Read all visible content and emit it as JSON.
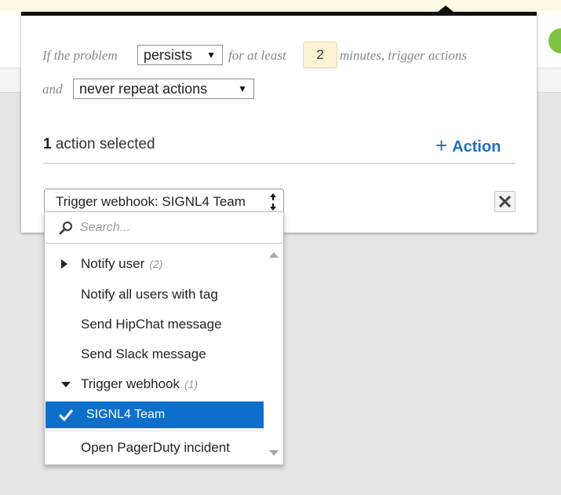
{
  "condition": {
    "prefix": "If the problem",
    "mode_value": "persists",
    "middle": "for at least",
    "minutes_value": "2",
    "suffix": "minutes, trigger actions",
    "and_label": "and",
    "repeat_value": "never repeat actions"
  },
  "actions": {
    "count": "1",
    "count_label": "action selected",
    "add_label": "Action"
  },
  "combo": {
    "value": "Trigger webhook: SIGNL4 Team"
  },
  "dropdown": {
    "search_placeholder": "Search...",
    "items": [
      {
        "label": "Notify user",
        "count": "(2)",
        "group": "collapsed"
      },
      {
        "label": "Notify all users with tag"
      },
      {
        "label": "Send HipChat message"
      },
      {
        "label": "Send Slack message"
      },
      {
        "label": "Trigger webhook",
        "count": "(1)",
        "group": "expanded"
      },
      {
        "label": "SIGNL4 Team",
        "selected": true
      },
      {
        "label": "Open PagerDuty incident"
      }
    ]
  },
  "colors": {
    "accent": "#1e6fc4",
    "selected_bg": "#0e6fca",
    "input_highlight": "#fcf4d4"
  }
}
